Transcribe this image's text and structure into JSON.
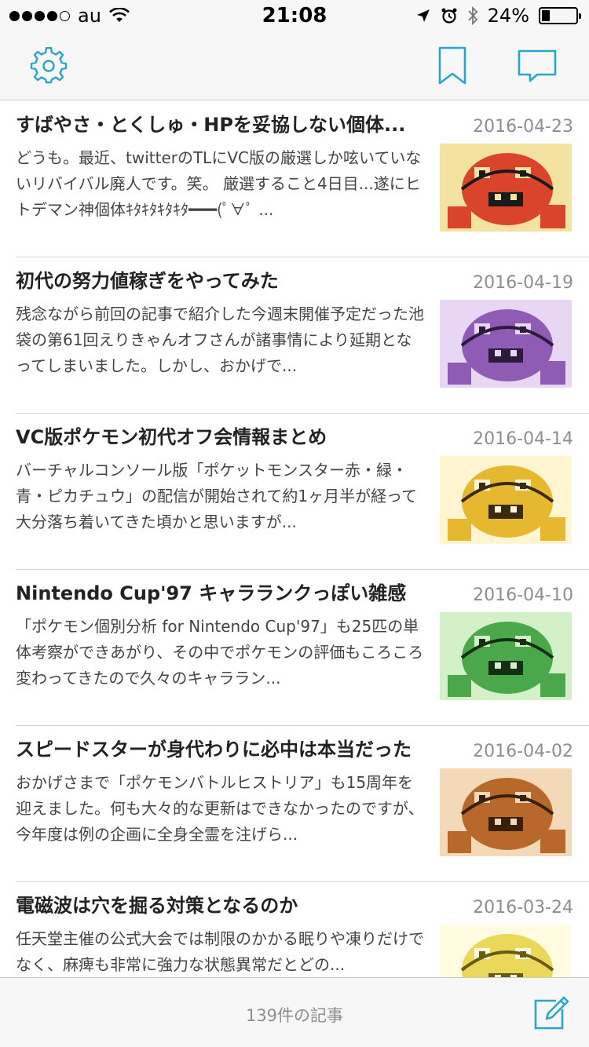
{
  "status": {
    "carrier": "au",
    "time": "21:08",
    "battery_percent": "24%",
    "battery_level": 0.24,
    "icons": [
      "signal-dots",
      "wifi-icon",
      "location-icon",
      "alarm-icon",
      "bluetooth-icon",
      "battery-icon"
    ]
  },
  "navbar": {
    "left_icon": "gear-icon",
    "right_icons": [
      "bookmark-icon",
      "comment-icon"
    ],
    "accent": "#2aa6c9"
  },
  "articles": [
    {
      "title": "すばやさ・とくしゅ・HPを妥協しない個体...",
      "date": "2016-04-23",
      "excerpt": "どうも。最近、twitterのTLにVC版の厳選しか呟いていないリバイバル廃人です。笑。 厳選すること4日目...遂にヒトデマン神個体ｷﾀｷﾀｷﾀｷﾀ━━━(ﾟ∀ﾟ ...",
      "thumb_colors": [
        "#d9442a",
        "#f4e2a0",
        "#1a1a1a"
      ]
    },
    {
      "title": "初代の努力値稼ぎをやってみた",
      "date": "2016-04-19",
      "excerpt": "残念ながら前回の記事で紹介した今週末開催予定だった池袋の第61回えりきゃんオフさんが諸事情により延期となってしまいました。しかし、おかげで...",
      "thumb_colors": [
        "#8e5bb5",
        "#e7d6f4",
        "#2b1a3a"
      ]
    },
    {
      "title": "VC版ポケモン初代オフ会情報まとめ",
      "date": "2016-04-14",
      "excerpt": "バーチャルコンソール版「ポケットモンスター赤・緑・青・ピカチュウ」の配信が開始されて約1ヶ月半が経って大分落ち着いてきた頃かと思いますが...",
      "thumb_colors": [
        "#e6b830",
        "#fff5d0",
        "#3a2a10"
      ]
    },
    {
      "title": "Nintendo Cup'97 キャラランクっぽい雑感",
      "date": "2016-04-10",
      "excerpt": "「ポケモン個別分析 for Nintendo Cup'97」も25匹の単体考察ができあがり、その中でポケモンの評価もころころ変わってきたので久々のキャララン...",
      "thumb_colors": [
        "#4aa84a",
        "#d4f0c8",
        "#143014"
      ]
    },
    {
      "title": "スピードスターが身代わりに必中は本当だった",
      "date": "2016-04-02",
      "excerpt": "おかげさまで「ポケモンバトルヒストリア」も15周年を迎えました。何も大々的な更新はできなかったのですが、今年度は例の企画に全身全霊を注げら...",
      "thumb_colors": [
        "#b8682a",
        "#f3d9b8",
        "#3a1f0a"
      ]
    },
    {
      "title": "電磁波は穴を掘る対策となるのか",
      "date": "2016-03-24",
      "excerpt": "任天堂主催の公式大会では制限のかかる眠りや凍りだけでなく、麻痺も非常に強力な状態異常だとどの...",
      "thumb_colors": [
        "#ead85a",
        "#fffbe0",
        "#6a5a10"
      ]
    }
  ],
  "footer": {
    "count_label": "139件の記事",
    "compose_icon": "compose-icon"
  }
}
